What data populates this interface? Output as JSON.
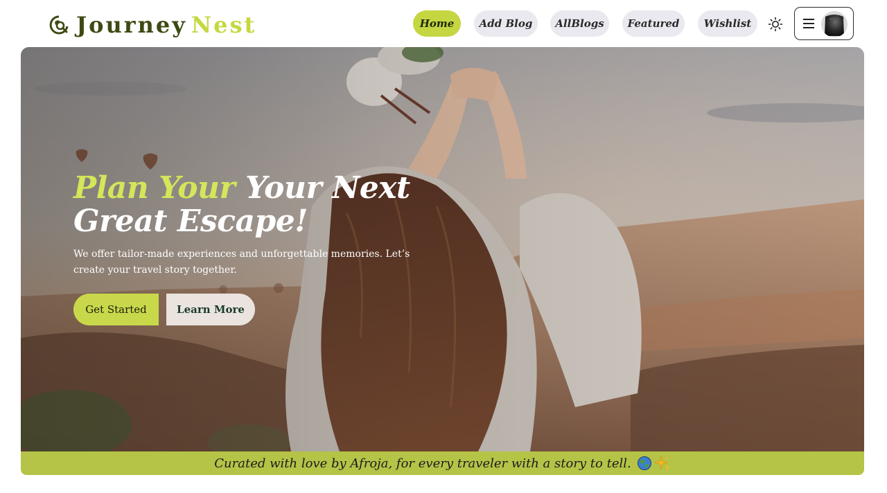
{
  "brand": {
    "name_part1": "Journey",
    "name_part2": "Nest",
    "icon": "globe-search-icon",
    "colors": {
      "dark": "#3d4a12",
      "accent": "#c6d840"
    }
  },
  "nav": {
    "items": [
      {
        "label": "Home",
        "active": true
      },
      {
        "label": "Add Blog",
        "active": false
      },
      {
        "label": "AllBlogs",
        "active": false
      },
      {
        "label": "Featured",
        "active": false
      },
      {
        "label": "Wishlist",
        "active": false
      }
    ],
    "theme_toggle_icon": "sun-icon",
    "menu_icon": "hamburger-icon",
    "avatar_icon": "user-avatar"
  },
  "hero": {
    "title_highlight": "Plan Your",
    "title_rest_line1": "Your Next",
    "title_line2": "Great Escape!",
    "description": "We offer tailor-made experiences and unforgettable memories. Let’s create your travel story together.",
    "primary_button": "Get Started",
    "secondary_button": "Learn More",
    "colors": {
      "highlight": "#d4e65a",
      "button_primary": "#c8d84a"
    }
  },
  "footer_strip": {
    "text": "Curated with love by Afroja, for every traveler with a story to tell.",
    "icons": [
      "globe-icon",
      "sparkles-icon"
    ],
    "color": "#b5c347"
  }
}
